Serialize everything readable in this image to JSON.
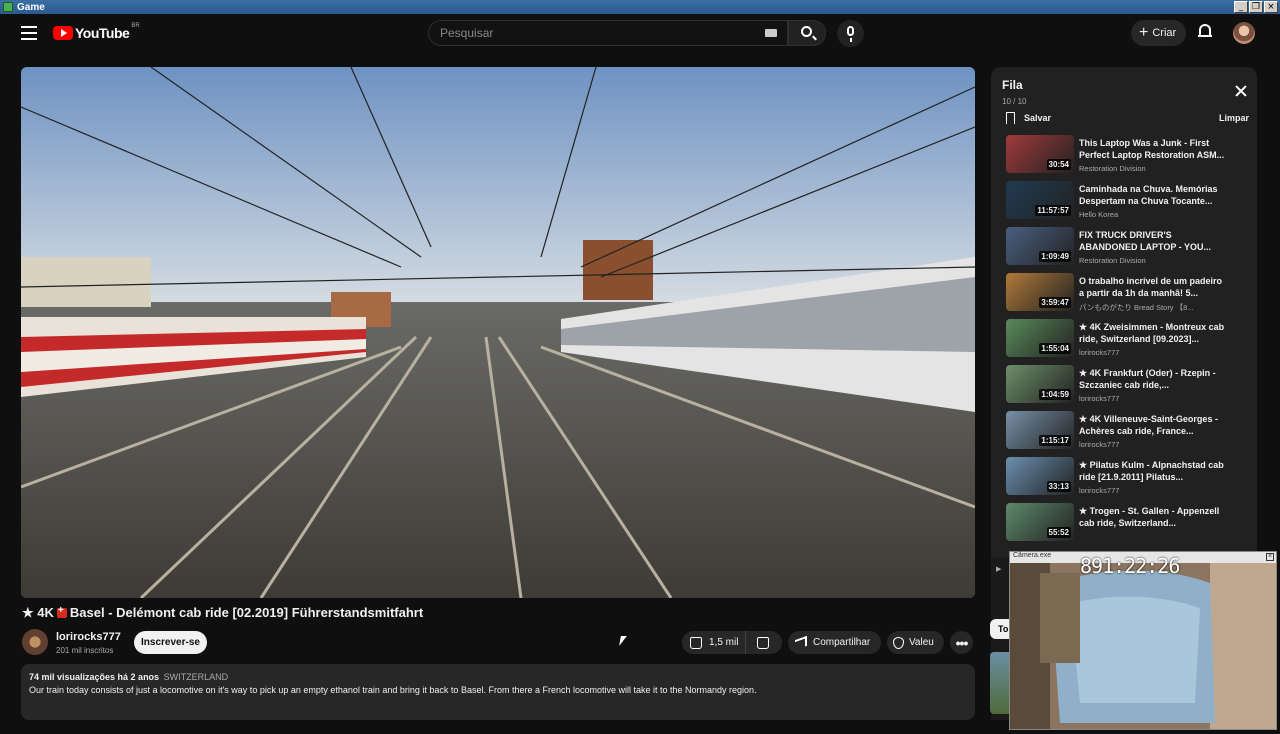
{
  "window": {
    "title": "Game"
  },
  "masthead": {
    "logo_text": "YouTube",
    "logo_country": "BR",
    "search_placeholder": "Pesquisar",
    "create_label": "Criar"
  },
  "video": {
    "title_prefix": "★ 4K",
    "title_rest": "Basel - Delémont cab ride [02.2019] Führerstandsmitfahrt",
    "channel": "lorirocks777",
    "subscribers": "201 mil inscritos",
    "subscribe_label": "Inscrever-se",
    "likes": "1,5 mil",
    "share_label": "Compartilhar",
    "thanks_label": "Valeu",
    "more_label": "•••",
    "views_date": "74 mil visualizações  há 2 anos",
    "location_tag": "SWITZERLAND",
    "description": "Our train today consists of just a locomotive on it's way to pick up an empty ethanol train and bring it back to Basel. From there a French locomotive will take it to the Normandy region."
  },
  "queue": {
    "title": "Fila",
    "count": "10 / 10",
    "save_label": "Salvar",
    "clear_label": "Limpar",
    "items": [
      {
        "title": "This Laptop Was a Junk - First Perfect Laptop Restoration ASM...",
        "channel": "Restoration Division",
        "duration": "30:54",
        "thumb": "#a23a3a"
      },
      {
        "title": "Caminhada na Chuva. Memórias Despertam na Chuva Tocante...",
        "channel": "Hello Korea",
        "duration": "11:57:57",
        "thumb": "#1f3b52"
      },
      {
        "title": "FIX TRUCK DRIVER'S ABANDONED LAPTOP - YOU...",
        "channel": "Restoration Division",
        "duration": "1:09:49",
        "thumb": "#4a5f80"
      },
      {
        "title": "O trabalho incrível de um padeiro a partir da 1h da manhã! 5...",
        "channel": "パンものがたり Bread Story  【8...",
        "duration": "3:59:47",
        "thumb": "#b07a3a"
      },
      {
        "title": "★ 4K  Zweisimmen - Montreux cab ride, Switzerland [09.2023]...",
        "channel": "lorirocks777",
        "duration": "1:55:04",
        "thumb": "#5a8a5a"
      },
      {
        "title": "★ 4K  Frankfurt (Oder) - Rzepin - Szczaniec cab ride,...",
        "channel": "lorirocks777",
        "duration": "1:04:59",
        "thumb": "#6d8f6a"
      },
      {
        "title": "★ 4K  Villeneuve-Saint-Georges - Achères cab ride, France...",
        "channel": "lorirocks777",
        "duration": "1:15:17",
        "thumb": "#7890a8"
      },
      {
        "title": "★  Pilatus Kulm - Alpnachstad cab ride [21.9.2011] Pilatus...",
        "channel": "lorirocks777",
        "duration": "33:13",
        "thumb": "#6a8fb0"
      },
      {
        "title": "★  Trogen - St. Gallen - Appenzell cab ride, Switzerland...",
        "channel": "",
        "duration": "55:52",
        "thumb": "#5e8a6a"
      }
    ]
  },
  "sidebar_chip": "To",
  "webcam": {
    "bar_label": "Câmera.exe",
    "timer": "891:22:26"
  },
  "colors": {
    "background": "#0f0f0f",
    "brand": "#ff0000",
    "panel": "#212121",
    "pill": "#272727"
  }
}
